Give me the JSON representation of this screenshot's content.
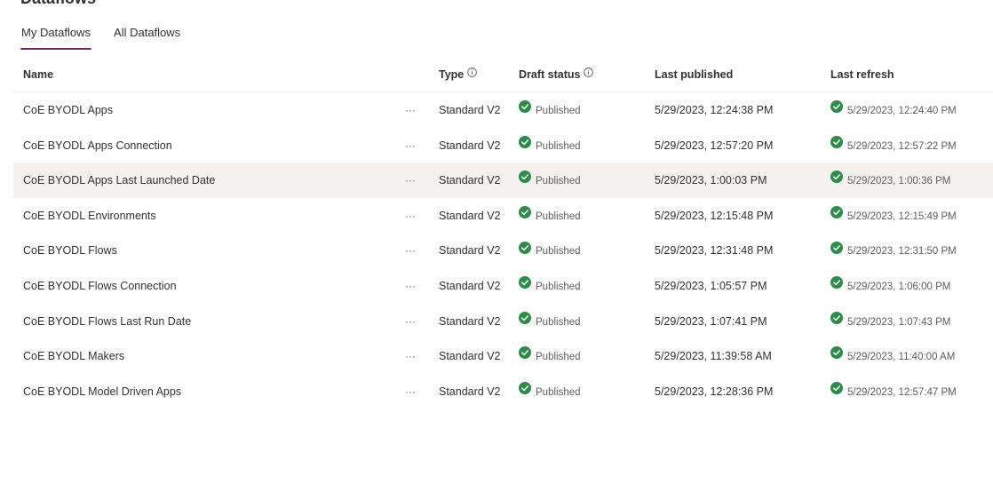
{
  "page": {
    "title": "Dataflows"
  },
  "tabs": [
    {
      "label": "My Dataflows",
      "active": true
    },
    {
      "label": "All Dataflows",
      "active": false
    }
  ],
  "columns": {
    "name": "Name",
    "type": "Type",
    "draft_status": "Draft status",
    "last_published": "Last published",
    "last_refresh": "Last refresh"
  },
  "more_label": "···",
  "colors": {
    "accent": "#742774",
    "success": "#2e8b4a",
    "hover_row": "#f3f2f1"
  },
  "icons": {
    "info": "info-icon",
    "success": "check-circle-icon",
    "more": "more-options-icon"
  },
  "rows": [
    {
      "name": "CoE BYODL Apps",
      "type": "Standard V2",
      "draft_status": "Published",
      "last_published": "5/29/2023, 12:24:38 PM",
      "last_refresh": "5/29/2023, 12:24:40 PM",
      "hovered": false
    },
    {
      "name": "CoE BYODL Apps Connection",
      "type": "Standard V2",
      "draft_status": "Published",
      "last_published": "5/29/2023, 12:57:20 PM",
      "last_refresh": "5/29/2023, 12:57:22 PM",
      "hovered": false
    },
    {
      "name": "CoE BYODL Apps Last Launched Date",
      "type": "Standard V2",
      "draft_status": "Published",
      "last_published": "5/29/2023, 1:00:03 PM",
      "last_refresh": "5/29/2023, 1:00:36 PM",
      "hovered": true
    },
    {
      "name": "CoE BYODL Environments",
      "type": "Standard V2",
      "draft_status": "Published",
      "last_published": "5/29/2023, 12:15:48 PM",
      "last_refresh": "5/29/2023, 12:15:49 PM",
      "hovered": false
    },
    {
      "name": "CoE BYODL Flows",
      "type": "Standard V2",
      "draft_status": "Published",
      "last_published": "5/29/2023, 12:31:48 PM",
      "last_refresh": "5/29/2023, 12:31:50 PM",
      "hovered": false
    },
    {
      "name": "CoE BYODL Flows Connection",
      "type": "Standard V2",
      "draft_status": "Published",
      "last_published": "5/29/2023, 1:05:57 PM",
      "last_refresh": "5/29/2023, 1:06:00 PM",
      "hovered": false
    },
    {
      "name": "CoE BYODL Flows Last Run Date",
      "type": "Standard V2",
      "draft_status": "Published",
      "last_published": "5/29/2023, 1:07:41 PM",
      "last_refresh": "5/29/2023, 1:07:43 PM",
      "hovered": false
    },
    {
      "name": "CoE BYODL Makers",
      "type": "Standard V2",
      "draft_status": "Published",
      "last_published": "5/29/2023, 11:39:58 AM",
      "last_refresh": "5/29/2023, 11:40:00 AM",
      "hovered": false
    },
    {
      "name": "CoE BYODL Model Driven Apps",
      "type": "Standard V2",
      "draft_status": "Published",
      "last_published": "5/29/2023, 12:28:36 PM",
      "last_refresh": "5/29/2023, 12:57:47 PM",
      "hovered": false
    }
  ]
}
